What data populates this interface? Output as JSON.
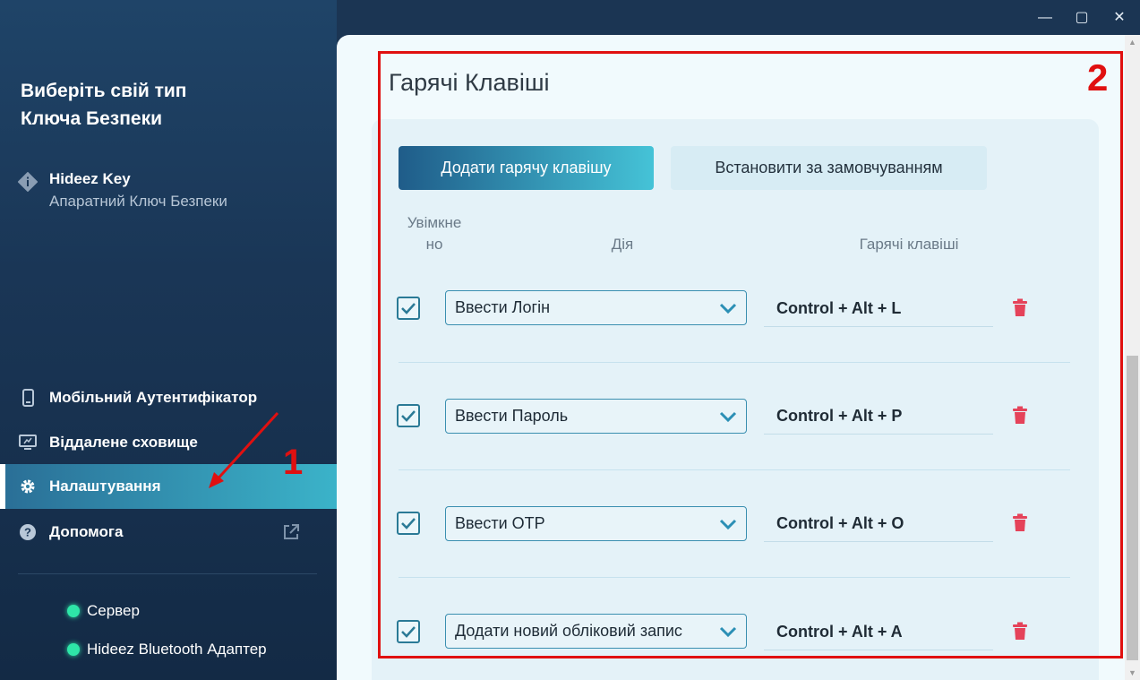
{
  "window": {
    "minimize": "—",
    "maximize": "▢",
    "close": "✕"
  },
  "sidebar": {
    "title_line1": "Виберіть свій тип",
    "title_line2": "Ключа Безпеки",
    "key": {
      "name": "Hideez Key",
      "subtitle": "Апаратний Ключ Безпеки"
    },
    "nav": [
      {
        "label": "Мобільний Аутентифікатор",
        "icon": "phone-icon"
      },
      {
        "label": "Віддалене сховище",
        "icon": "monitor-icon"
      },
      {
        "label": "Налаштування",
        "icon": "gear-icon",
        "active": true
      },
      {
        "label": "Допомога",
        "icon": "help-icon"
      }
    ],
    "status": [
      {
        "label": "Сервер",
        "color": "#2ee6a8"
      },
      {
        "label": "Hideez Bluetooth Адаптер",
        "color": "#2ee6a8"
      }
    ]
  },
  "annotations": {
    "one": "1",
    "two": "2"
  },
  "main": {
    "title": "Гарячі Клавіші",
    "add_button": "Додати гарячу клавішу",
    "default_button": "Встановити за замовчуванням",
    "headers": {
      "enabled_line1": "Увімкне",
      "enabled_line2": "но",
      "action": "Дія",
      "hotkeys": "Гарячі клавіші"
    },
    "rows": [
      {
        "enabled": true,
        "action": "Ввести Логін",
        "hotkey": "Control + Alt + L"
      },
      {
        "enabled": true,
        "action": "Ввести Пароль",
        "hotkey": "Control + Alt + P"
      },
      {
        "enabled": true,
        "action": "Ввести OTP",
        "hotkey": "Control + Alt + O"
      },
      {
        "enabled": true,
        "action": "Додати новий обліковий запис",
        "hotkey": "Control + Alt + A"
      }
    ]
  },
  "colors": {
    "accent": "#3bb3c9",
    "delete": "#e5435a",
    "annotation": "#e01010"
  }
}
